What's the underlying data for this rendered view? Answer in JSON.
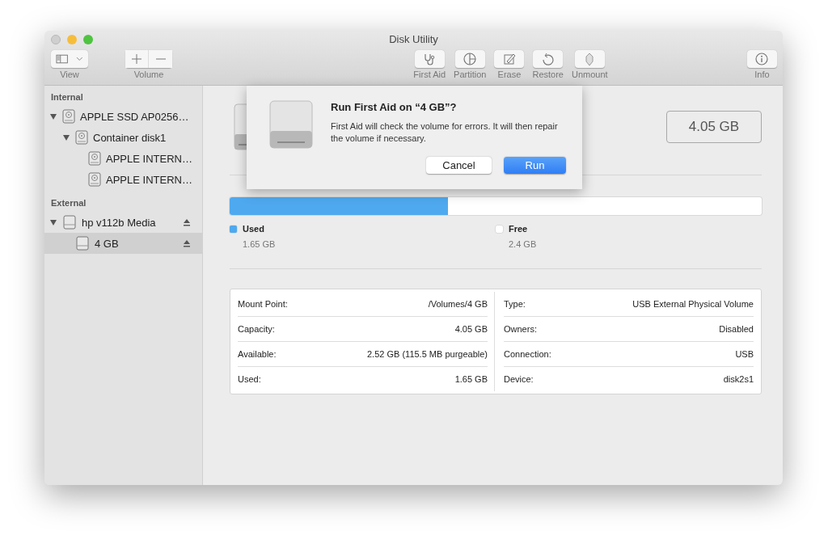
{
  "window": {
    "title": "Disk Utility"
  },
  "toolbar": {
    "left": [
      {
        "kind": "view",
        "label": "View"
      },
      {
        "kind": "volume",
        "label": "Volume"
      }
    ],
    "center": [
      {
        "kind": "firstaid",
        "label": "First Aid"
      },
      {
        "kind": "partition",
        "label": "Partition"
      },
      {
        "kind": "erase",
        "label": "Erase"
      },
      {
        "kind": "restore",
        "label": "Restore"
      },
      {
        "kind": "unmount",
        "label": "Unmount"
      }
    ],
    "right": [
      {
        "kind": "info",
        "label": "Info"
      }
    ]
  },
  "sidebar": {
    "sections": [
      {
        "title": "Internal",
        "items": [
          {
            "label": "APPLE SSD AP0256…",
            "kind": "internal",
            "expanded": true,
            "selected": false,
            "eject": false,
            "children": [
              {
                "label": "Container disk1",
                "kind": "internal",
                "expanded": true,
                "selected": false,
                "eject": false,
                "children": [
                  {
                    "label": "APPLE INTERN…",
                    "kind": "internal",
                    "selected": false,
                    "eject": false
                  },
                  {
                    "label": "APPLE INTERN…",
                    "kind": "internal",
                    "selected": false,
                    "eject": false
                  }
                ]
              }
            ]
          }
        ]
      },
      {
        "title": "External",
        "items": [
          {
            "label": "hp v112b Media",
            "kind": "external",
            "expanded": true,
            "selected": false,
            "eject": true,
            "children": [
              {
                "label": "4 GB",
                "kind": "external",
                "selected": true,
                "eject": true
              }
            ]
          }
        ]
      }
    ]
  },
  "header": {
    "capacity": "4.05 GB"
  },
  "usage": {
    "level": 0.41,
    "legend": [
      {
        "label": "Used",
        "value": "1.65 GB",
        "color": "#4fa9ef"
      },
      {
        "label": "Free",
        "value": "2.4 GB",
        "color": "#ffffff"
      }
    ]
  },
  "details": {
    "left": [
      {
        "label": "Mount Point:",
        "value": "/Volumes/4 GB"
      },
      {
        "label": "Capacity:",
        "value": "4.05 GB"
      },
      {
        "label": "Available:",
        "value": "2.52 GB (115.5 MB purgeable)"
      },
      {
        "label": "Used:",
        "value": "1.65 GB"
      }
    ],
    "right": [
      {
        "label": "Type:",
        "value": "USB External Physical Volume"
      },
      {
        "label": "Owners:",
        "value": "Disabled"
      },
      {
        "label": "Connection:",
        "value": "USB"
      },
      {
        "label": "Device:",
        "value": "disk2s1"
      }
    ]
  },
  "sheet": {
    "title": "Run First Aid on “4 GB”?",
    "message": "First Aid will check the volume for errors. It will then repair the volume if necessary.",
    "buttons": [
      {
        "label": "Cancel",
        "default": false
      },
      {
        "label": "Run",
        "default": true
      }
    ]
  }
}
